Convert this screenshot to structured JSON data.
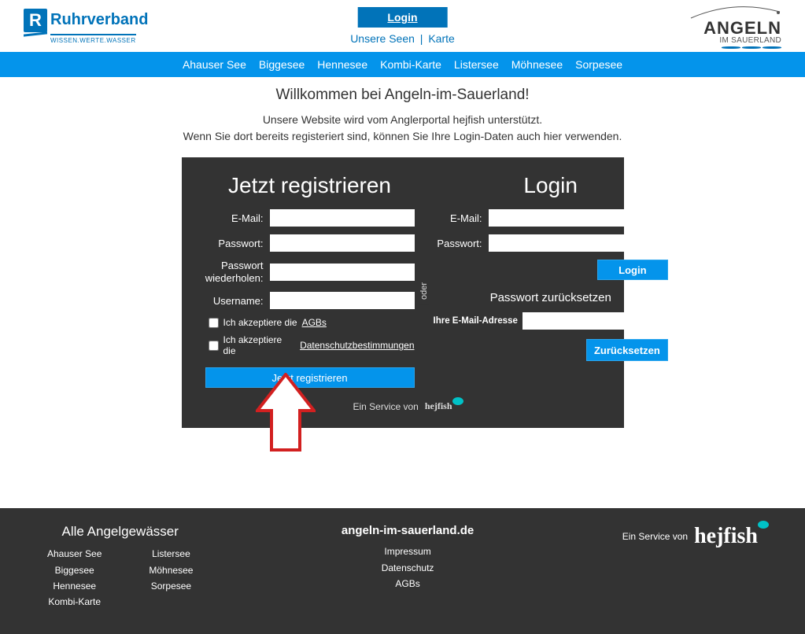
{
  "top": {
    "login_chip": "Login",
    "link_seen": "Unsere Seen",
    "sep": "|",
    "link_karte": "Karte"
  },
  "logo_left": {
    "letter": "R",
    "brand": "Ruhrverband",
    "sub": "WISSEN.WERTE.WASSER"
  },
  "logo_right": {
    "main": "ANGELN",
    "sub": "IM SAUERLAND"
  },
  "nav": {
    "items": [
      "Ahauser See",
      "Biggesee",
      "Hennesee",
      "Kombi-Karte",
      "Listersee",
      "Möhnesee",
      "Sorpesee"
    ]
  },
  "intro": {
    "heading": "Willkommen bei Angeln-im-Sauerland!",
    "line1": "Unsere Website wird vom Anglerportal hejfish unterstützt.",
    "line2": "Wenn Sie dort bereits registeriert sind, können Sie Ihre Login-Daten auch hier verwenden."
  },
  "panel": {
    "register_heading": "Jetzt registrieren",
    "login_heading": "Login",
    "oder": "oder",
    "labels": {
      "email": "E-Mail:",
      "password": "Passwort:",
      "password_repeat": "Passwort wiederholen:",
      "username": "Username:",
      "reset_heading": "Passwort zurücksetzen",
      "reset_email": "Ihre E-Mail-Adresse"
    },
    "agb_prefix": "Ich akzeptiere die ",
    "agb_link": "AGBs",
    "ds_prefix": "Ich akzeptiere die ",
    "ds_link": "Datenschutzbestimmungen",
    "register_btn": "Jetzt registrieren",
    "login_btn": "Login",
    "reset_btn": "Zurücksetzen",
    "service_text": "Ein Service von",
    "hejfish": "hejfish"
  },
  "footer": {
    "left_heading": "Alle Angelgewässer",
    "lakes_col1": [
      "Ahauser See",
      "Biggesee",
      "Hennesee",
      "Kombi-Karte"
    ],
    "lakes_col2": [
      "Listersee",
      "Möhnesee",
      "Sorpesee"
    ],
    "center_heading": "angeln-im-sauerland.de",
    "center_links": [
      "Impressum",
      "Datenschutz",
      "AGBs"
    ],
    "service_text": "Ein Service von",
    "hejfish": "hejfish"
  }
}
